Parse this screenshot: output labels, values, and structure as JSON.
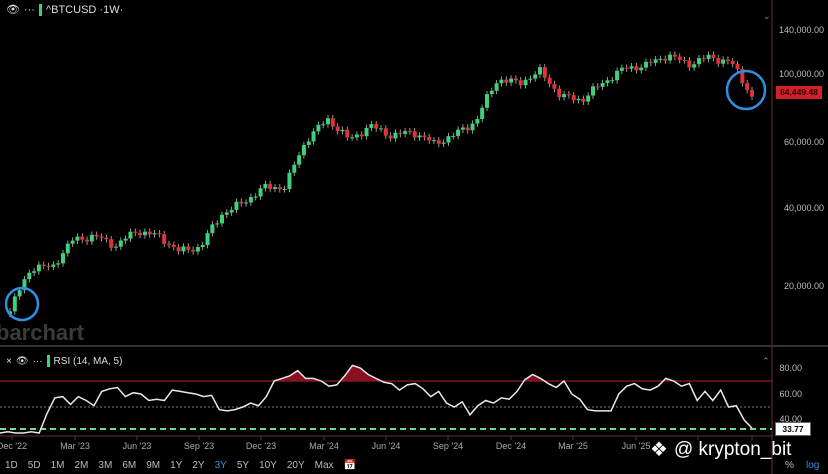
{
  "header": {
    "symbol": "^BTCUSD",
    "interval": "1W",
    "title": "^BTCUSD ·1W·"
  },
  "price_axis": {
    "labels": [
      "140,000.00",
      "100,000.00",
      "60,000.00",
      "40,000.00",
      "20,000.00"
    ],
    "ticks": [
      140000,
      100000,
      60000,
      40000,
      20000
    ],
    "scale": "log",
    "last_price": "84,449.48",
    "last_price_color": "#d22028"
  },
  "rsi": {
    "title": "RSI (14, MA, 5)",
    "labels": [
      "80.00",
      "60.00",
      "40.00"
    ],
    "ticks": [
      80,
      60,
      40
    ],
    "current": "33.77",
    "overbought": 70,
    "midline": 50,
    "oversold": 30,
    "values": [
      30,
      31,
      30,
      30,
      31,
      30,
      45,
      57,
      58,
      52,
      58,
      55,
      51,
      62,
      64,
      65,
      58,
      61,
      60,
      55,
      56,
      55,
      63,
      62,
      61,
      60,
      58,
      59,
      48,
      47,
      48,
      50,
      53,
      51,
      58,
      70,
      72,
      74,
      78,
      72,
      72,
      70,
      66,
      67,
      74,
      82,
      80,
      75,
      72,
      69,
      68,
      63,
      67,
      68,
      64,
      58,
      62,
      53,
      50,
      54,
      44,
      51,
      55,
      53,
      57,
      56,
      62,
      71,
      75,
      72,
      68,
      65,
      70,
      60,
      56,
      48,
      47,
      47,
      47,
      60,
      66,
      68,
      64,
      63,
      66,
      72,
      70,
      66,
      68,
      55,
      62,
      55,
      63,
      50,
      51,
      40,
      33.77
    ]
  },
  "date_axis": [
    "Dec '22",
    "Mar '23",
    "Jun '23",
    "Sep '23",
    "Dec '23",
    "Mar '24",
    "Jun '24",
    "Sep '24",
    "Dec '24",
    "Mar '25",
    "Jun '25"
  ],
  "timeframes": [
    "1D",
    "5D",
    "1M",
    "2M",
    "3M",
    "6M",
    "9M",
    "1Y",
    "2Y",
    "3Y",
    "5Y",
    "10Y",
    "20Y",
    "Max"
  ],
  "active_timeframe": "3Y",
  "right_controls": {
    "percent": "%",
    "log": "log"
  },
  "brand_watermark": "barchart",
  "user_watermark": "@ krypton_bit",
  "colors": {
    "up": "#3fd07a",
    "down": "#e0323a",
    "highlight_circle": "#2f8fe0",
    "rsi_line": "#e8e8e8",
    "overbought": "#c02030",
    "oversold": "#6fe08a"
  },
  "chart_data": {
    "type": "candlestick",
    "period": "weekly",
    "monthly_closes_usd": [
      16500,
      23000,
      23100,
      28500,
      29200,
      27200,
      30500,
      29200,
      26000,
      27000,
      34600,
      37700,
      42300,
      42500,
      61000,
      71000,
      60600,
      67500,
      62700,
      64600,
      59000,
      63300,
      70200,
      96400,
      93400,
      102000,
      84300,
      82500,
      94200,
      104600,
      107000,
      115700,
      108000,
      114000,
      109500,
      84449.48
    ],
    "ylim": [
      12000,
      160000
    ]
  }
}
